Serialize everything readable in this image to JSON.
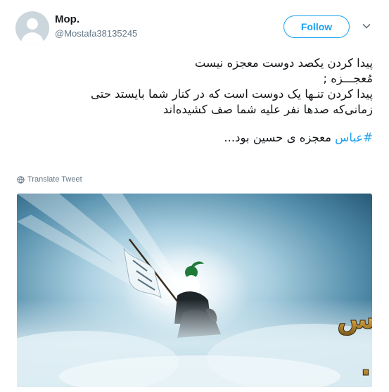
{
  "tweet": {
    "display_name": "Mop.",
    "handle": "@Mostafa38135245",
    "follow_label": "Follow",
    "text_lines": [
      "پیدا کردن یکصد دوست معجزه نیست",
      "مُعجـــزه ;",
      "پیدا کردن تنـها یک دوست است که در کنار شما بایستد حتی",
      "زمانی‌که صدها نفر علیه شما صف کشیده‌اند"
    ],
    "hashtag": "#عباس",
    "last_line_rest": " معجزه ی حسین بود...",
    "translate_label": "Translate Tweet"
  },
  "media": {
    "caption_line1": "عبــاس",
    "caption_line2": "معجزه ی حسـین بود ..."
  },
  "colors": {
    "accent": "#1da1f2",
    "text": "#14171a",
    "muted": "#657786"
  },
  "icons": [
    "default-avatar-icon",
    "chevron-down-icon",
    "globe-icon"
  ]
}
